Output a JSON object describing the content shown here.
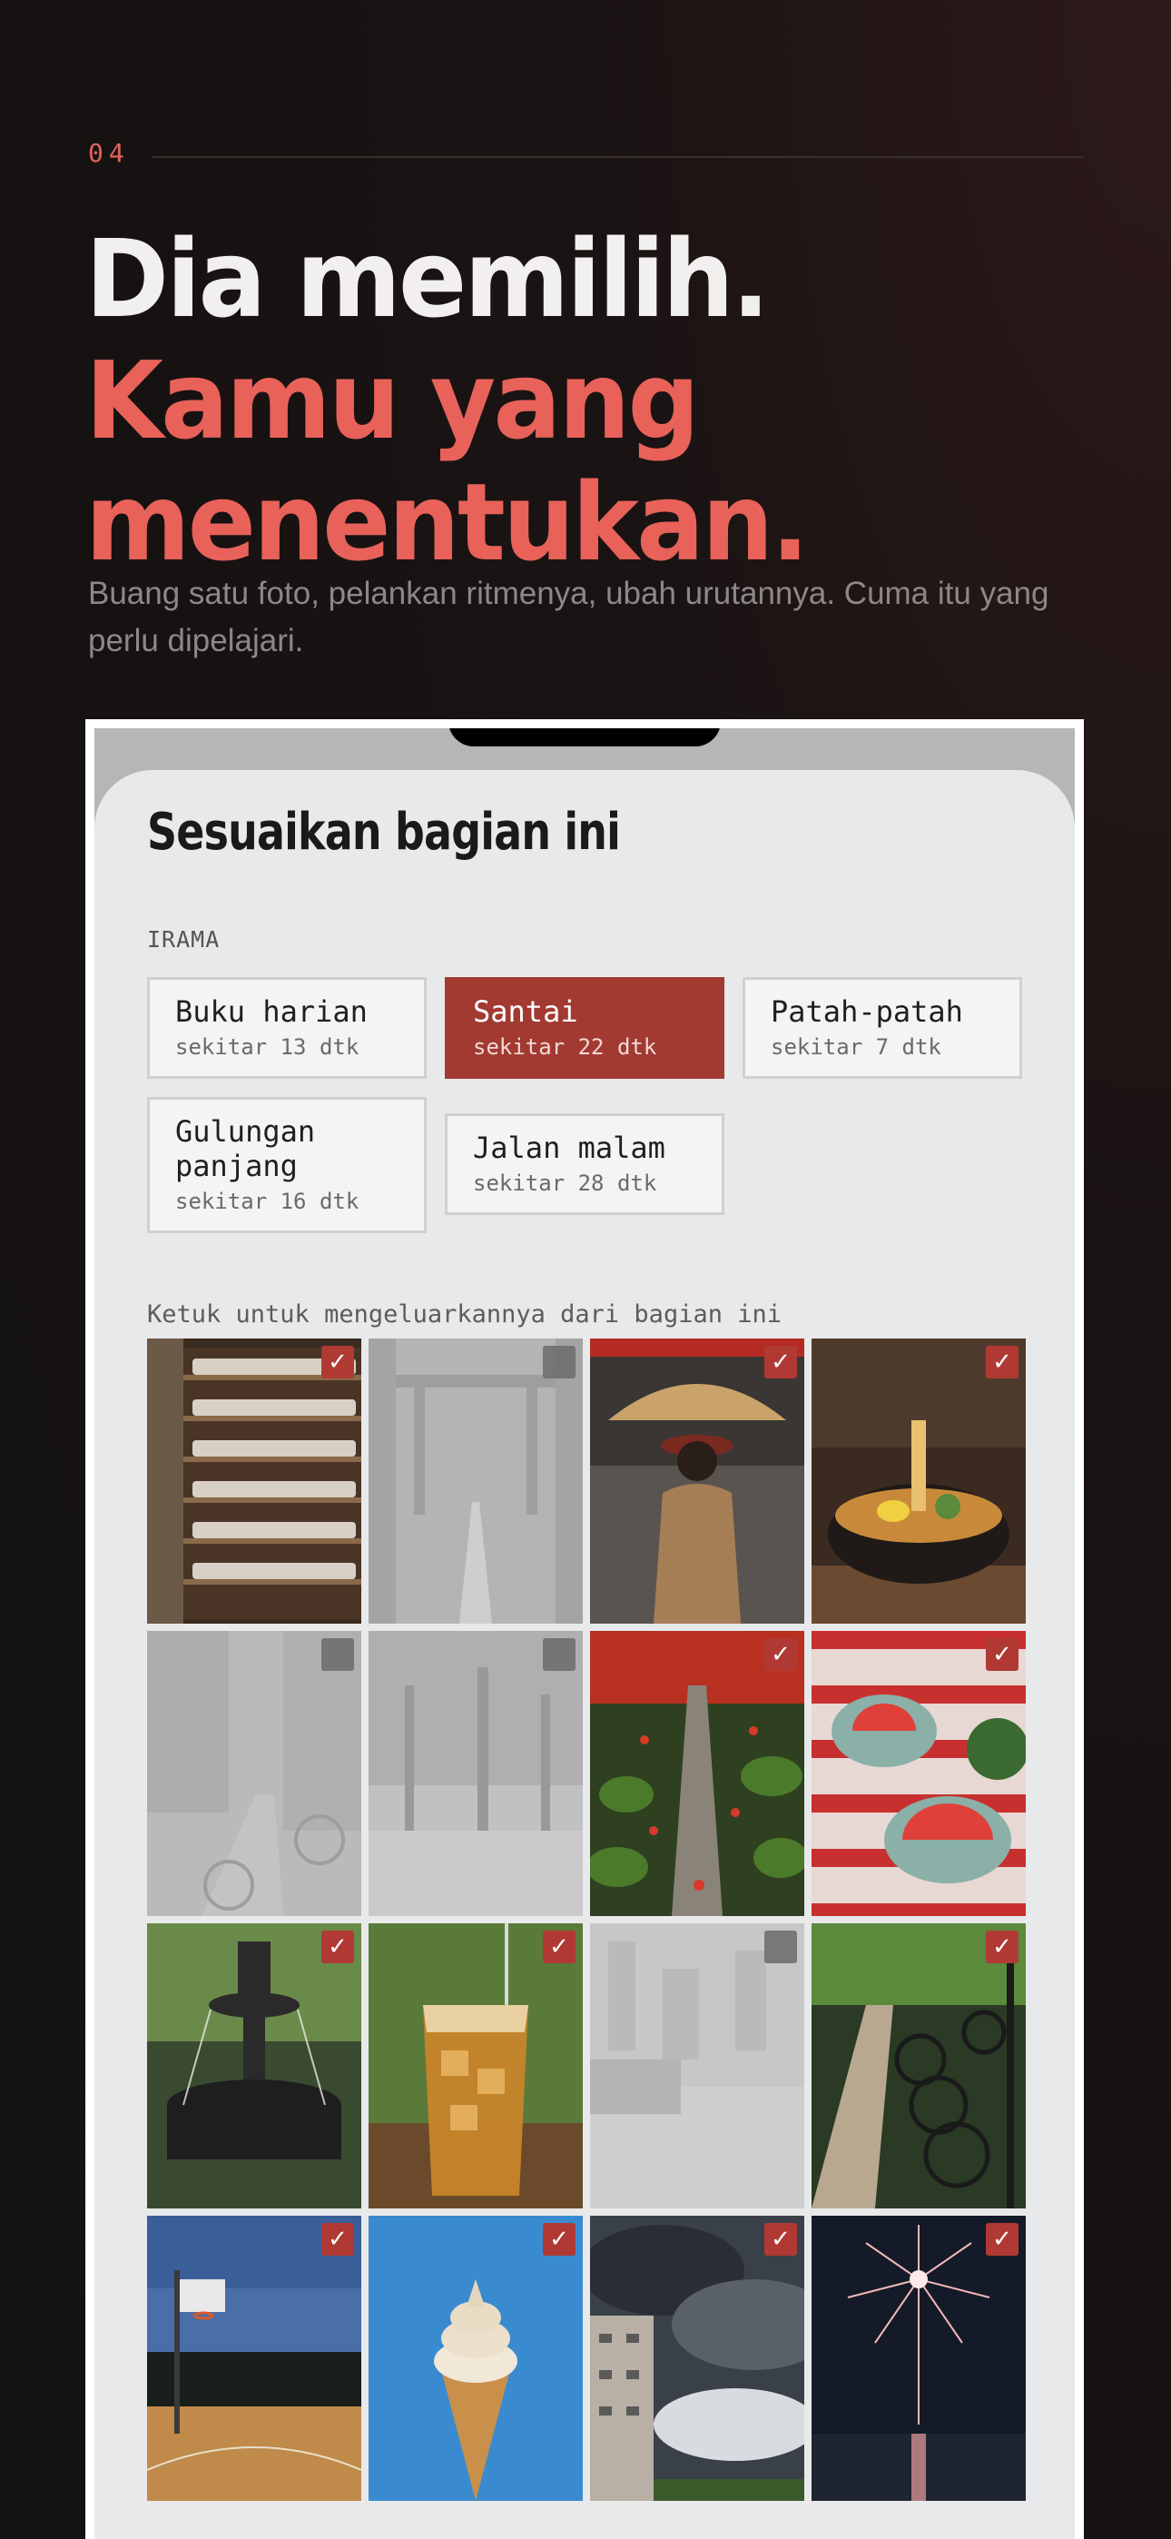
{
  "section": {
    "number": "04"
  },
  "headline": {
    "line1": "Dia memilih.",
    "line2": "Kamu yang menentukan."
  },
  "subtitle": "Buang satu foto, pelankan ritmenya, ubah urutannya. Cuma itu yang perlu dipelajari.",
  "sheet": {
    "title": "Sesuaikan bagian ini",
    "rhythm_label": "IRAMA",
    "rhythms": [
      {
        "name": "Buku harian",
        "duration": "sekitar 13 dtk",
        "selected": false
      },
      {
        "name": "Santai",
        "duration": "sekitar 22 dtk",
        "selected": true
      },
      {
        "name": "Patah-patah",
        "duration": "sekitar 7 dtk",
        "selected": false
      },
      {
        "name": "Gulungan panjang",
        "duration": "sekitar 16 dtk",
        "selected": false
      },
      {
        "name": "Jalan malam",
        "duration": "sekitar 28 dtk",
        "selected": false
      }
    ],
    "grid_hint": "Ketuk untuk mengeluarkannya dari bagian ini",
    "photos": [
      {
        "subject": "cup-shelves",
        "included": true
      },
      {
        "subject": "torii-path",
        "included": false
      },
      {
        "subject": "umbrella-street",
        "included": true
      },
      {
        "subject": "ramen-bowl",
        "included": true
      },
      {
        "subject": "canal-bicycle",
        "included": false
      },
      {
        "subject": "park-trees",
        "included": false
      },
      {
        "subject": "maple-stone-path",
        "included": true
      },
      {
        "subject": "watermelon-picnic",
        "included": true
      },
      {
        "subject": "fountain",
        "included": true
      },
      {
        "subject": "iced-tea",
        "included": true
      },
      {
        "subject": "city-rooftops",
        "included": false
      },
      {
        "subject": "bicycle-rack",
        "included": true
      },
      {
        "subject": "basketball-court",
        "included": true
      },
      {
        "subject": "ice-cream-cone",
        "included": true
      },
      {
        "subject": "storm-clouds",
        "included": true
      },
      {
        "subject": "fireworks",
        "included": true
      }
    ]
  },
  "colors": {
    "accent": "#e8625a",
    "selected_chip": "#a23a32",
    "checkbox": "#b03a33",
    "sheet_bg": "#e8e9ea"
  }
}
